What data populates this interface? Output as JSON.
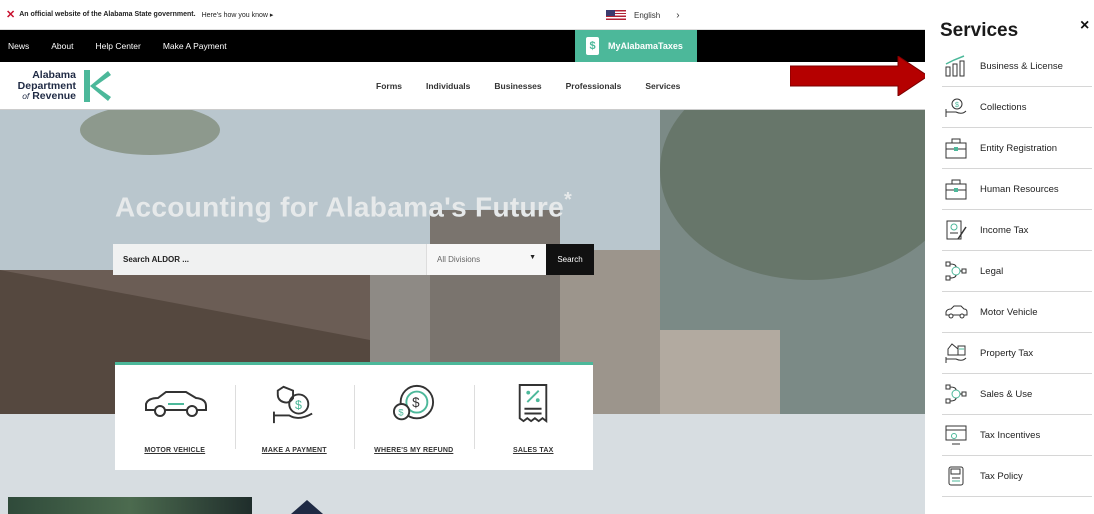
{
  "official_banner": {
    "bold_text": "An official website of the Alabama State government.",
    "link_text": "Here’s how you know",
    "chevron": "▸"
  },
  "language": {
    "label": "English",
    "chevron": "›"
  },
  "top_nav": [
    "News",
    "About",
    "Help Center",
    "Make A Payment"
  ],
  "myalabamataxes": {
    "label": "MyAlabamaTaxes",
    "icon": "dollar-document-icon"
  },
  "logo": {
    "line1": "Alabama",
    "line2": "Department",
    "line3_prefix": "of",
    "line3": "Revenue"
  },
  "main_nav": [
    "Forms",
    "Individuals",
    "Businesses",
    "Professionals",
    "Services"
  ],
  "hero": {
    "title": "Accounting for Alabama's Future",
    "title_mark": "*"
  },
  "search": {
    "placeholder": "Search ALDOR ...",
    "division": "All Divisions",
    "button": "Search"
  },
  "quick_links": [
    {
      "label": "MOTOR VEHICLE",
      "icon": "car-icon"
    },
    {
      "label": "MAKE A PAYMENT",
      "icon": "hand-payment-icon"
    },
    {
      "label": "WHERE'S MY REFUND",
      "icon": "refund-coin-icon"
    },
    {
      "label": "SALES TAX",
      "icon": "receipt-icon"
    }
  ],
  "services_panel": {
    "title": "Services",
    "close": "×",
    "items": [
      {
        "label": "Business & License",
        "icon": "bar-growth-icon"
      },
      {
        "label": "Collections",
        "icon": "hand-money-icon"
      },
      {
        "label": "Entity Registration",
        "icon": "briefcase-icon"
      },
      {
        "label": "Human Resources",
        "icon": "briefcase-icon"
      },
      {
        "label": "Income Tax",
        "icon": "document-pen-icon"
      },
      {
        "label": "Legal",
        "icon": "gavel-network-icon"
      },
      {
        "label": "Motor Vehicle",
        "icon": "car-icon"
      },
      {
        "label": "Property Tax",
        "icon": "house-hand-icon"
      },
      {
        "label": "Sales & Use",
        "icon": "network-icon"
      },
      {
        "label": "Tax Incentives",
        "icon": "screen-icon"
      },
      {
        "label": "Tax Policy",
        "icon": "tax-scroll-icon"
      }
    ]
  },
  "colors": {
    "accent": "#4cb89a",
    "navy": "#1f2a44",
    "arrow": "#c00000"
  }
}
